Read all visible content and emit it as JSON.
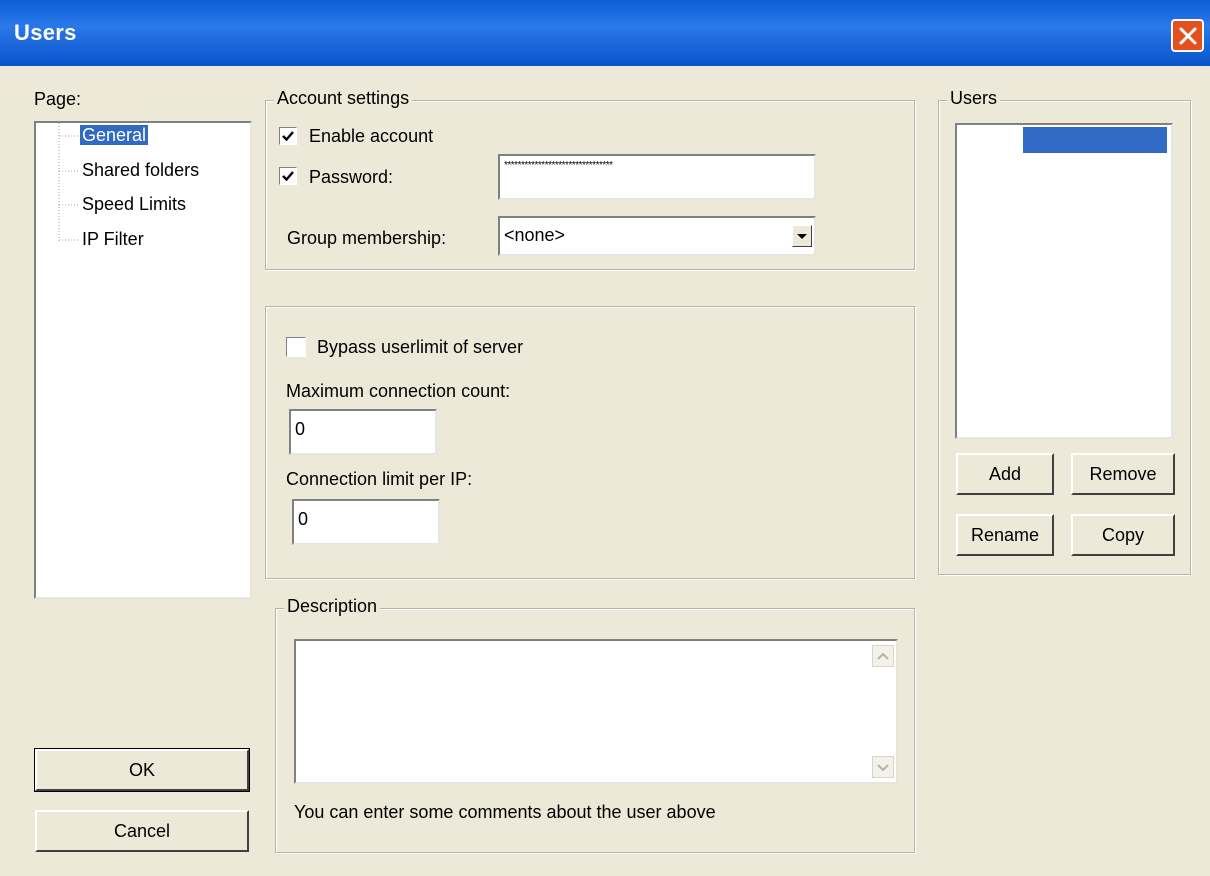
{
  "window": {
    "title": "Users"
  },
  "page_panel": {
    "label": "Page:",
    "items": [
      {
        "label": "General",
        "selected": true
      },
      {
        "label": "Shared folders"
      },
      {
        "label": "Speed Limits"
      },
      {
        "label": "IP Filter"
      }
    ]
  },
  "account": {
    "legend": "Account settings",
    "enable_label": "Enable account",
    "enable_checked": true,
    "password_label": "Password:",
    "password_checked": true,
    "password_value": "********************************",
    "group_label": "Group membership:",
    "group_value": "<none>"
  },
  "limits": {
    "bypass_label": "Bypass userlimit of server",
    "bypass_checked": false,
    "max_conn_label": "Maximum connection count:",
    "max_conn_value": "0",
    "per_ip_label": "Connection limit per IP:",
    "per_ip_value": "0"
  },
  "description": {
    "legend": "Description",
    "value": "",
    "hint": "You can enter some comments about the user above"
  },
  "users_panel": {
    "legend": "Users",
    "add": "Add",
    "remove": "Remove",
    "rename": "Rename",
    "copy": "Copy"
  },
  "buttons": {
    "ok": "OK",
    "cancel": "Cancel"
  },
  "colors": {
    "title_bar": "#0a5fd8",
    "selection": "#316ac5",
    "face": "#ece9d8",
    "close": "#e4511e"
  }
}
